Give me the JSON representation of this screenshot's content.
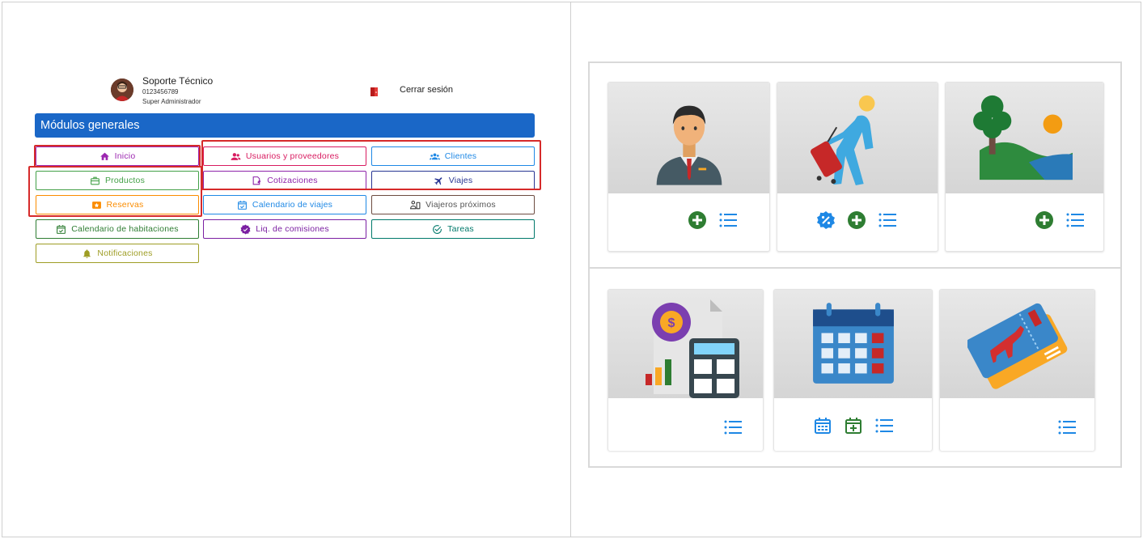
{
  "user": {
    "name": "Soporte Técnico",
    "phone": "0123456789",
    "role": "Super Administrador"
  },
  "logout_label": "Cerrar sesión",
  "section_title": "Módulos generales",
  "modules": {
    "inicio": "Inicio",
    "usuarios": "Usuarios y proveedores",
    "clientes": "Clientes",
    "productos": "Productos",
    "cotizaciones": "Cotizaciones",
    "viajes": "Viajes",
    "reservas": "Reservas",
    "calendario_viajes": "Calendario de viajes",
    "viajeros_proximos": "Viajeros próximos",
    "calendario_habitaciones": "Calendario de habitaciones",
    "liq_comisiones": "Liq. de comisiones",
    "tareas": "Tareas",
    "notificaciones": "Notificaciones"
  },
  "colors": {
    "brand_blue": "#1a67c7",
    "inicio": "#9c27b0",
    "usuarios": "#d81b60",
    "clientes": "#1e88e5",
    "productos": "#43a047",
    "cotizaciones": "#8e24aa",
    "viajes": "#283593",
    "reservas": "#fb8c00",
    "calendario_viajes": "#1e88e5",
    "viajeros_proximos": "#6d4c41",
    "calendario_habitaciones": "#2e7d32",
    "liq_comisiones": "#7b1fa2",
    "tareas": "#00796b",
    "notificaciones": "#9e9d24",
    "highlight": "#d62a2a",
    "action_green": "#2e7d32",
    "action_blue": "#1e88e5"
  },
  "cards": [
    {
      "name": "usuarios-card",
      "image": "business-man-icon",
      "actions": [
        "add-icon",
        "list-icon"
      ]
    },
    {
      "name": "clientes-card",
      "image": "traveler-icon",
      "actions": [
        "discount-badge-icon",
        "add-icon",
        "list-icon"
      ]
    },
    {
      "name": "productos-card",
      "image": "landscape-icon",
      "actions": [
        "add-icon",
        "list-icon"
      ]
    },
    {
      "name": "cotizaciones-card",
      "image": "accounting-icon",
      "actions": [
        "list-icon"
      ]
    },
    {
      "name": "calendario-card",
      "image": "calendar-icon",
      "actions": [
        "calendar-view-icon",
        "calendar-add-icon",
        "list-icon"
      ]
    },
    {
      "name": "viajes-card",
      "image": "flight-ticket-icon",
      "actions": [
        "list-icon"
      ]
    }
  ]
}
